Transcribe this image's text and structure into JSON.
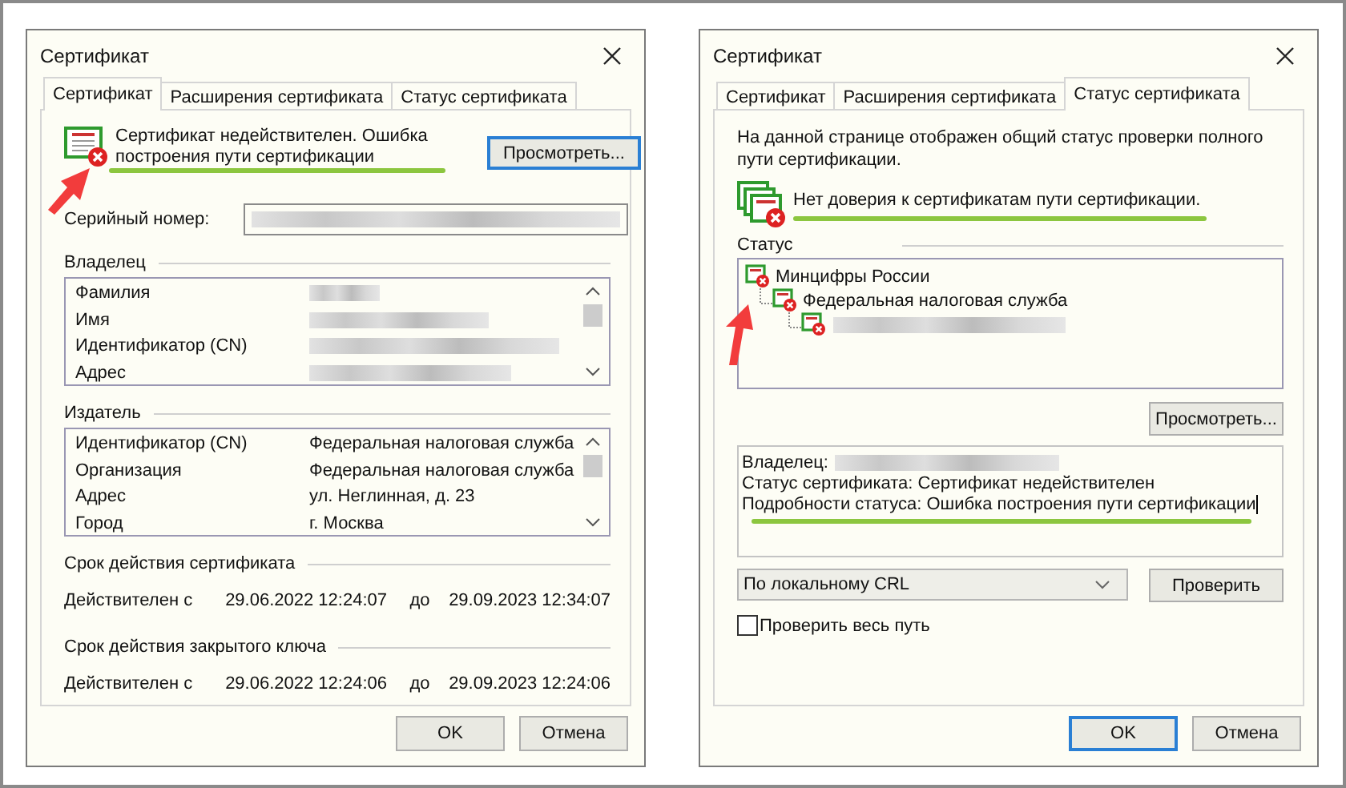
{
  "dialogs": [
    {
      "kind": "general",
      "title": "Сертификат",
      "tabs": [
        {
          "label": "Сертификат",
          "selected": true
        },
        {
          "label": "Расширения сертификата",
          "selected": false
        },
        {
          "label": "Статус сертификата",
          "selected": false
        }
      ],
      "annotation_arrow": true,
      "status": {
        "message": "Сертификат недействителен. Ошибка построения пути сертификации",
        "underlined": true,
        "button": "Просмотреть...",
        "button_focused": true
      },
      "serial": {
        "label": "Серийный номер:",
        "redacted": true
      },
      "owner": {
        "heading": "Владелец",
        "rows": [
          {
            "label": "Фамилия",
            "redacted": true
          },
          {
            "label": "Имя",
            "redacted": true
          },
          {
            "label": "Идентификатор (CN)",
            "redacted": true
          },
          {
            "label": "Адрес",
            "redacted": true
          }
        ]
      },
      "issuer": {
        "heading": "Издатель",
        "rows": [
          {
            "label": "Идентификатор (CN)",
            "value": "Федеральная налоговая служба"
          },
          {
            "label": "Организация",
            "value": "Федеральная налоговая служба"
          },
          {
            "label": "Адрес",
            "value": "ул. Неглинная, д. 23"
          },
          {
            "label": "Город",
            "value": "г. Москва"
          }
        ]
      },
      "validity": [
        {
          "heading": "Срок действия сертификата",
          "from_label": "Действителен с",
          "from": "29.06.2022 12:24:07",
          "to_label": "до",
          "to": "29.09.2023 12:34:07"
        },
        {
          "heading": "Срок действия закрытого ключа",
          "from_label": "Действителен с",
          "from": "29.06.2022 12:24:06",
          "to_label": "до",
          "to": "29.09.2023 12:24:06"
        }
      ],
      "buttons": [
        {
          "label": "OK",
          "focused": false
        },
        {
          "label": "Отмена",
          "focused": false
        }
      ]
    },
    {
      "kind": "status",
      "title": "Сертификат",
      "tabs": [
        {
          "label": "Сертификат",
          "selected": false
        },
        {
          "label": "Расширения сертификата",
          "selected": false
        },
        {
          "label": "Статус сертификата",
          "selected": true
        }
      ],
      "annotation_arrow": true,
      "description": "На данной странице отображен общий статус проверки полного пути сертификации.",
      "status": {
        "message": "Нет доверия к сертификатам пути сертификации.",
        "underlined": true
      },
      "status_heading": "Статус",
      "tree": [
        {
          "label": "Минцифры России",
          "children": [
            {
              "label": "Федеральная налоговая служба",
              "children": [
                {
                  "redacted": true
                }
              ]
            }
          ]
        }
      ],
      "view_button": "Просмотреть...",
      "details": [
        {
          "text": "Владелец:",
          "redacted": true
        },
        {
          "text": "Статус сертификата: Сертификат недействителен",
          "redacted": false
        },
        {
          "text": "Подробности статуса: Ошибка построения пути сертификации",
          "redacted": false,
          "cursor": true
        }
      ],
      "details_underlined": true,
      "mode": "По локальному CRL",
      "check_button": "Проверить",
      "check_all": {
        "label": "Проверить весь путь",
        "checked": false
      },
      "buttons": [
        {
          "label": "OK",
          "focused": true
        },
        {
          "label": "Отмена",
          "focused": false
        }
      ]
    }
  ]
}
